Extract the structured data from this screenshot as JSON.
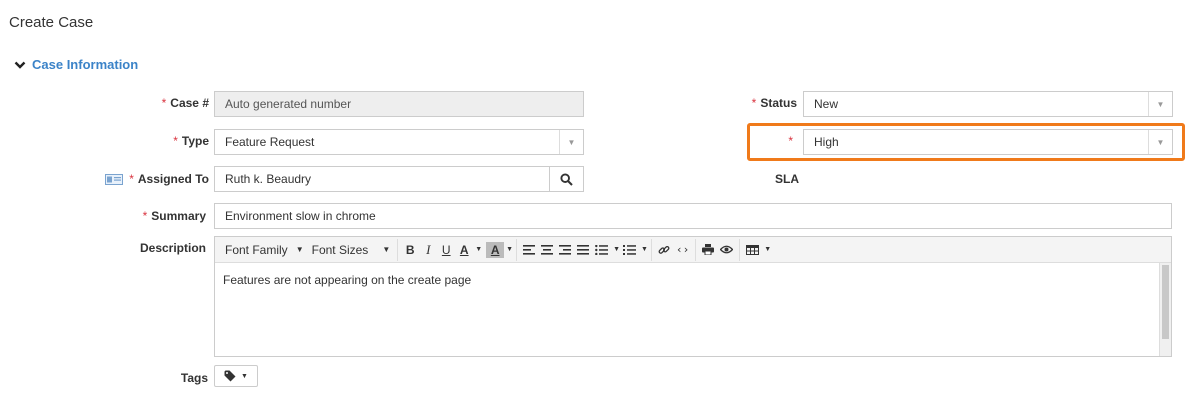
{
  "page": {
    "title": "Create Case"
  },
  "section": {
    "title": "Case Information"
  },
  "fields": {
    "case_number": {
      "label": "Case #",
      "value": "Auto generated number"
    },
    "type": {
      "label": "Type",
      "value": "Feature Request"
    },
    "assigned_to": {
      "label": "Assigned To",
      "value": "Ruth k. Beaudry"
    },
    "summary": {
      "label": "Summary",
      "value": "Environment slow in chrome"
    },
    "description": {
      "label": "Description",
      "body": "Features are not appearing on the create page"
    },
    "tags": {
      "label": "Tags"
    },
    "status": {
      "label": "Status",
      "value": "New"
    },
    "priority": {
      "value": "High"
    },
    "sla": {
      "label": "SLA"
    }
  },
  "required_marker": "*",
  "toolbar": {
    "font_family": "Font Family",
    "font_sizes": "Font Sizes",
    "bold": "B",
    "italic": "I",
    "underline": "U",
    "font_color": "A",
    "highlight": "A"
  },
  "colors": {
    "accent": "#3b83c8",
    "required": "#d9333f",
    "highlight_border": "#f07a1a"
  }
}
